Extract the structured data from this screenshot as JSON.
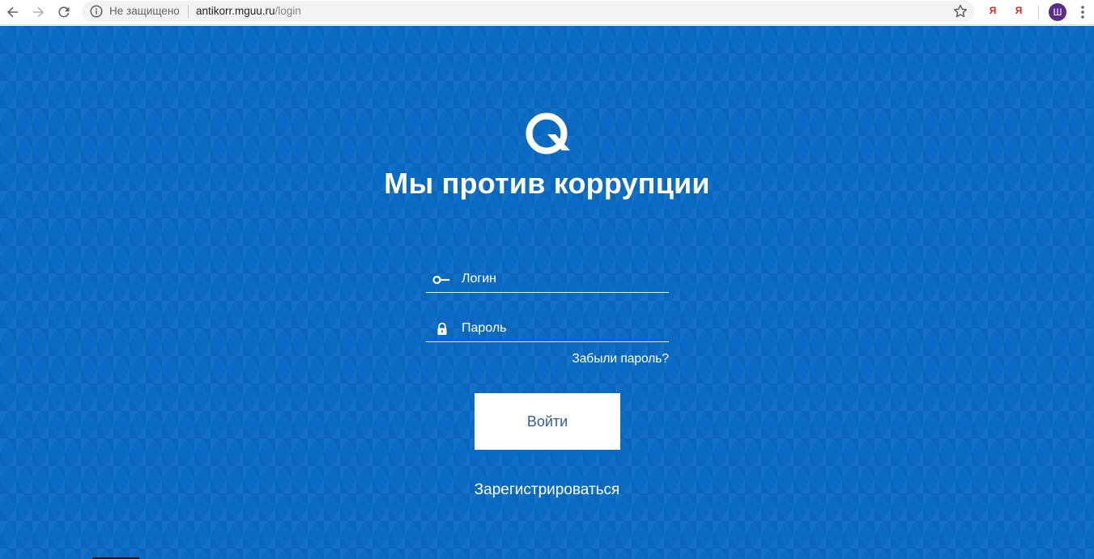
{
  "browser": {
    "security_label": "Не защищено",
    "url_host": "antikorr.mguu.ru",
    "url_path": "/login",
    "extension_1": "Я",
    "extension_2": "Я",
    "profile_initial": "Ш",
    "icons": {
      "back": "arrow-left-icon",
      "forward": "arrow-right-icon",
      "reload": "reload-icon",
      "info": "info-icon",
      "bookmark": "star-icon",
      "menu": "kebab-menu-icon"
    }
  },
  "page": {
    "logo_icon": "q-logo-icon",
    "title": "Мы против коррупции",
    "login": {
      "placeholder": "Логин",
      "value": "",
      "icon": "key-icon"
    },
    "password": {
      "placeholder": "Пароль",
      "value": "",
      "icon": "lock-icon"
    },
    "forgot_password": "Забыли пароль?",
    "submit_label": "Войти",
    "register_label": "Зарегистрироваться",
    "colors": {
      "background": "#0a6bc4",
      "button_text": "#2a5ea7",
      "text": "#ffffff"
    }
  }
}
